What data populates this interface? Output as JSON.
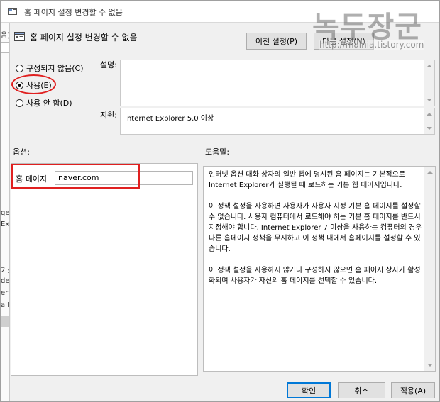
{
  "window": {
    "title": "홈 페이지 설정 변경할 수 없음"
  },
  "background_app": {
    "fragments": [
      "음)",
      "ge",
      "Exp",
      "기:",
      "de",
      "er",
      "a P"
    ]
  },
  "header": {
    "title": "홈 페이지 설정 변경할 수 없음",
    "prev_button": "이전 설정(P)",
    "next_button": "다음 설정(N)"
  },
  "state": {
    "options": [
      {
        "label": "구성되지 않음(C)",
        "checked": false
      },
      {
        "label": "사용(E)",
        "checked": true
      },
      {
        "label": "사용 안 함(D)",
        "checked": false
      }
    ]
  },
  "comment": {
    "label": "설명:",
    "value": ""
  },
  "supported": {
    "label": "지원:",
    "value": "Internet Explorer 5.0 이상"
  },
  "options_section": {
    "label": "옵션:",
    "homepage_label": "홈 페이지",
    "homepage_value": "naver.com"
  },
  "help_section": {
    "label": "도움말:",
    "paragraphs": [
      "인터넷 옵션 대화 상자의 일반 탭에 명시된 홈 페이지는 기본적으로 Internet Explorer가 실행될 때 로드하는 기본 웹 페이지입니다.",
      "이 정책 설정을 사용하면 사용자가 사용자 지정 기본 홈 페이지를 설정할 수 없습니다. 사용자 컴퓨터에서 로드해야 하는 기본 홈 페이지를 반드시 지정해야 합니다. Internet Explorer 7 이상을 사용하는 컴퓨터의 경우 다른 홈페이지 정책을 무시하고 이 정책 내에서 홈페이지를 설정할 수 있습니다.",
      "이 정책 설정을 사용하지 않거나 구성하지 않으면 홈 페이지 상자가 활성화되며 사용자가 자신의 홈 페이지를 선택할 수 있습니다."
    ]
  },
  "footer": {
    "ok": "확인",
    "cancel": "취소",
    "apply": "적용(A)"
  },
  "watermark": {
    "logo": "녹두장군",
    "url": "http://mainia.tistory.com"
  },
  "colors": {
    "highlight": "#e02020",
    "focus": "#0078d7"
  }
}
